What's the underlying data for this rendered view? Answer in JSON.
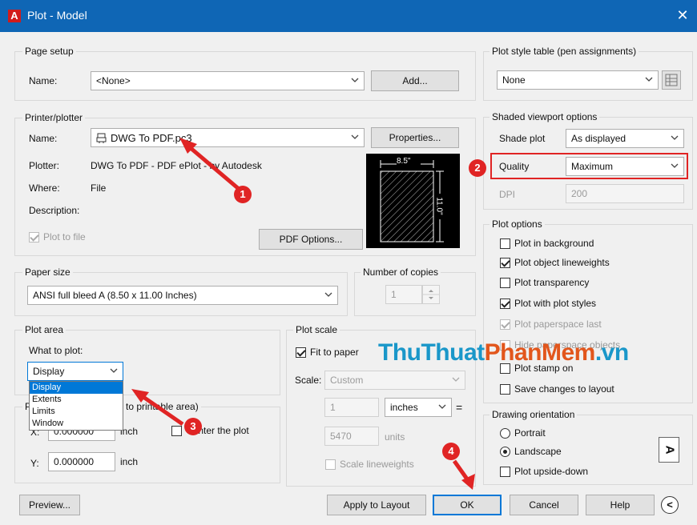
{
  "window": {
    "title": "Plot - Model",
    "app_icon": "autocad-logo",
    "close_glyph": "✕"
  },
  "page_setup": {
    "group_label": "Page setup",
    "name_label": "Name:",
    "name_value": "<None>",
    "add_button": "Add..."
  },
  "printer": {
    "group_label": "Printer/plotter",
    "name_label": "Name:",
    "name_value": "DWG To PDF.pc3",
    "properties_button": "Properties...",
    "plotter_label": "Plotter:",
    "plotter_value": "DWG To PDF - PDF ePlot - by Autodesk",
    "where_label": "Where:",
    "where_value": "File",
    "description_label": "Description:",
    "plot_to_file_label": "Plot to file",
    "plot_to_file_checked": true,
    "pdf_options_button": "PDF Options...",
    "preview_width": "8.5\"",
    "preview_height": "11.0\""
  },
  "paper_size": {
    "group_label": "Paper size",
    "value": "ANSI full bleed A (8.50 x 11.00 Inches)"
  },
  "copies": {
    "group_label": "Number of copies",
    "value": "1"
  },
  "plot_area": {
    "group_label": "Plot area",
    "what_label": "What to plot:",
    "selected": "Display",
    "options": [
      "Display",
      "Extents",
      "Limits",
      "Window"
    ]
  },
  "plot_offset": {
    "group_label_fragment": "to printable area)",
    "x_label": "X:",
    "x_value": "0.000000",
    "x_unit": "inch",
    "y_label": "Y:",
    "y_value": "0.000000",
    "y_unit": "inch",
    "center_label": "Center the plot",
    "center_checked": false
  },
  "plot_scale": {
    "group_label": "Plot scale",
    "fit_label": "Fit to paper",
    "fit_checked": true,
    "scale_label": "Scale:",
    "scale_value": "Custom",
    "units_value": "1",
    "units_unit": "inches",
    "equals": "=",
    "units2_value": "5470",
    "units2_label": "units",
    "lineweights_label": "Scale lineweights",
    "lineweights_checked": false
  },
  "plot_style": {
    "group_label": "Plot style table (pen assignments)",
    "value": "None",
    "edit_icon": "edit-table-icon"
  },
  "shaded": {
    "group_label": "Shaded viewport options",
    "shade_label": "Shade plot",
    "shade_value": "As displayed",
    "quality_label": "Quality",
    "quality_value": "Maximum",
    "dpi_label": "DPI",
    "dpi_value": "200"
  },
  "plot_options": {
    "group_label": "Plot options",
    "items": [
      {
        "label": "Plot in background",
        "checked": false,
        "enabled": true
      },
      {
        "label": "Plot object lineweights",
        "checked": true,
        "enabled": true
      },
      {
        "label": "Plot transparency",
        "checked": false,
        "enabled": true
      },
      {
        "label": "Plot with plot styles",
        "checked": true,
        "enabled": true
      },
      {
        "label": "Plot paperspace last",
        "checked": true,
        "enabled": false
      },
      {
        "label": "Hide paperspace objects",
        "checked": false,
        "enabled": false
      },
      {
        "label": "Plot stamp on",
        "checked": false,
        "enabled": true
      },
      {
        "label": "Save changes to layout",
        "checked": false,
        "enabled": true
      }
    ]
  },
  "orientation": {
    "group_label": "Drawing orientation",
    "portrait": "Portrait",
    "landscape": "Landscape",
    "selected": "Landscape",
    "upside_down": "Plot upside-down",
    "upside_down_checked": false,
    "icon_glyph": "A"
  },
  "footer": {
    "preview": "Preview...",
    "apply": "Apply to Layout",
    "ok": "OK",
    "cancel": "Cancel",
    "help": "Help",
    "collapse_glyph": "<"
  },
  "annotations": {
    "markers": [
      "1",
      "2",
      "3",
      "4"
    ],
    "highlight_color": "#e02424"
  },
  "watermark": {
    "part1": "ThuThuat",
    "part2": "PhanMem",
    "part3": ".vn"
  }
}
